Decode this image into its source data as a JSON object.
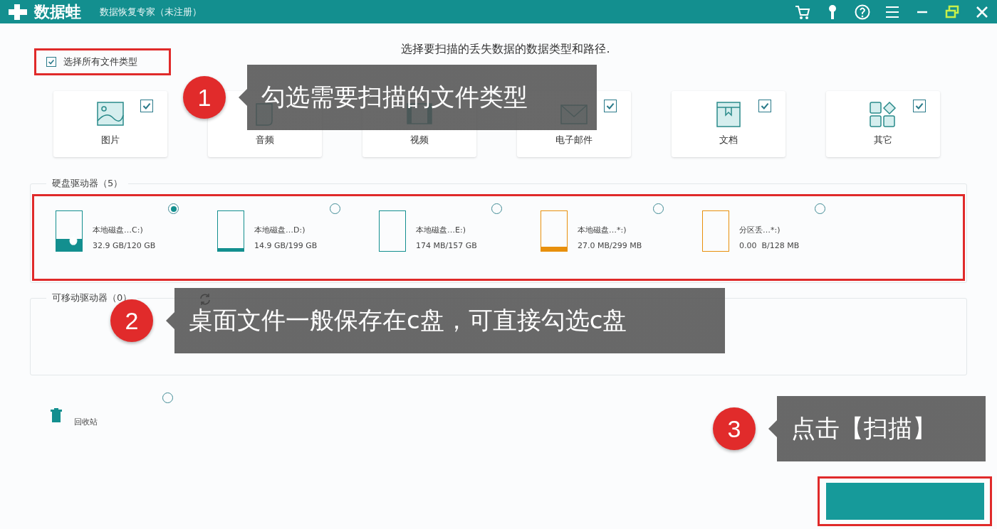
{
  "window": {
    "app_name": "数据蛙",
    "title": "数据恢复专家（未注册）"
  },
  "heading": "选择要扫描的丢失数据的数据类型和路径.",
  "select_all": {
    "label": "选择所有文件类型",
    "checked": true
  },
  "file_types": [
    {
      "kind": "image",
      "label": "图片",
      "checked": true
    },
    {
      "kind": "audio",
      "label": "音频"
    },
    {
      "kind": "video",
      "label": "视频"
    },
    {
      "kind": "email",
      "label": "电子邮件",
      "checked": true
    },
    {
      "kind": "document",
      "label": "文档",
      "checked": true
    },
    {
      "kind": "other",
      "label": "其它",
      "checked": true
    }
  ],
  "hard_drives": {
    "title": "硬盘驱动器（5）",
    "items": [
      {
        "name": "本地磁盘…C:)",
        "size": "32.9 GB/120 GB",
        "level": 0.3,
        "color": "#138f8f",
        "selected": true,
        "system": true
      },
      {
        "name": "本地磁盘…D:)",
        "size": "14.9 GB/199 GB",
        "level": 0.08,
        "color": "#138f8f",
        "selected": false
      },
      {
        "name": "本地磁盘…E:)",
        "size": "174 MB/157 GB",
        "level": 0,
        "color": "#138f8f",
        "selected": false
      },
      {
        "name": "本地磁盘…*:)",
        "size": "27.0 MB/299 MB",
        "level": 0.1,
        "color": "#e8900c",
        "selected": false
      },
      {
        "name": "分区丢…*:)",
        "size": "0.00  B/128 MB",
        "level": 0,
        "color": "#e8900c",
        "selected": false
      }
    ]
  },
  "removable_drives": {
    "title": "可移动驱动器（0）"
  },
  "recycle_bin": {
    "label": "回收站",
    "selected": false
  },
  "callouts": [
    {
      "number": "1",
      "text": "勾选需要扫描的文件类型"
    },
    {
      "number": "2",
      "text": "桌面文件一般保存在c盘，可直接勾选c盘"
    },
    {
      "number": "3",
      "text": "点击【扫描】"
    }
  ]
}
